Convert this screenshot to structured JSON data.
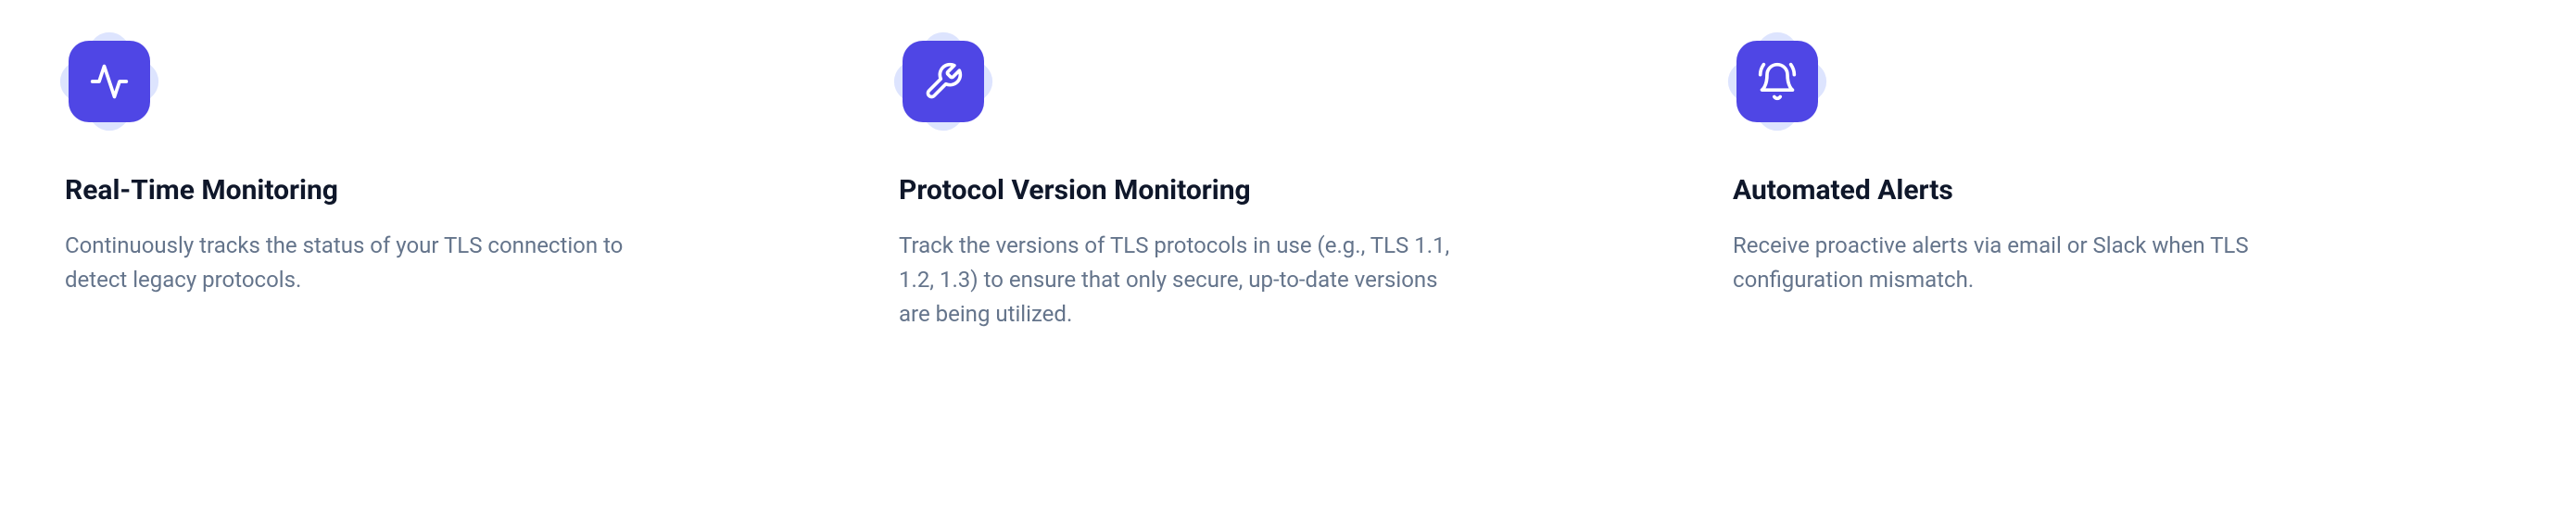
{
  "features": [
    {
      "icon": "activity-icon",
      "title": "Real-Time Monitoring",
      "description": "Continuously tracks the status of your TLS connection to detect legacy protocols."
    },
    {
      "icon": "wrench-icon",
      "title": "Protocol Version Monitoring",
      "description": "Track the versions of TLS protocols in use (e.g., TLS 1.1, 1.2, 1.3) to ensure that only secure, up-to-date versions are being utilized."
    },
    {
      "icon": "bell-icon",
      "title": "Automated Alerts",
      "description": "Receive proactive alerts via email or Slack when TLS configuration mismatch."
    }
  ]
}
